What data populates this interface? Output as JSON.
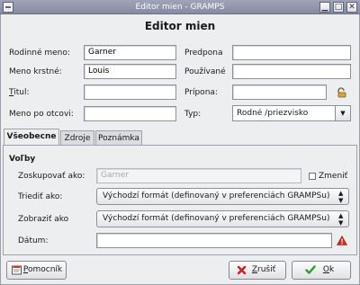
{
  "window": {
    "title": "Editor mien - GRAMPS",
    "menu_icon": "window-menu-icon",
    "controls": [
      "minimize-icon",
      "maximize-icon",
      "close-icon"
    ],
    "minimize_glyph": "▁",
    "maximize_glyph": "□",
    "close_glyph": "✕"
  },
  "heading": "Editor mien",
  "fields": {
    "rodinne_meno": {
      "label": "Rodinné meno:",
      "value": "Garner"
    },
    "predpona": {
      "label": "Predpona",
      "value": ""
    },
    "meno_krstne": {
      "label": "Meno krstné:",
      "value": "Louis"
    },
    "pouzivane": {
      "label": "Používané",
      "value": ""
    },
    "titul": {
      "label_mnemonic": "T",
      "label_rest": "itul:",
      "value": ""
    },
    "pripona": {
      "label": "Prípona:",
      "value": ""
    },
    "meno_po_otcovi": {
      "label": "Meno po otcovi:",
      "value": ""
    },
    "typ": {
      "label": "Typ:",
      "value": "Rodné /priezvisko",
      "arrow": "▼"
    }
  },
  "icons": {
    "lock": "lock-icon",
    "date_warning": "date-warning-icon"
  },
  "tabs": [
    {
      "label": "Všeobecne",
      "active": true
    },
    {
      "label": "Zdroje",
      "active": false
    },
    {
      "label": "Poznámka",
      "active": false
    }
  ],
  "general": {
    "section_title": "Voľby",
    "zoskupovat": {
      "label": "Zoskupovať ako:",
      "placeholder": "Garner",
      "checkbox_label": "Zmeniť",
      "checkbox_checked": false
    },
    "triedit": {
      "label": "Triediť ako:",
      "value": "Východzí formát (definovaný v preferenciách GRAMPSu)"
    },
    "zobrazit": {
      "label": "Zobraziť ako",
      "value": "Východzí formát (definovaný v preferenciách GRAMPSu)"
    },
    "datum": {
      "label": "Dátum:",
      "value": ""
    },
    "updown_arrows": "▲▼"
  },
  "buttons": {
    "help": {
      "mnemonic": "P",
      "rest": "omocník",
      "icon": "help-icon"
    },
    "cancel": {
      "mnemonic": "Z",
      "rest": "rušiť",
      "icon": "cancel-icon"
    },
    "ok": {
      "mnemonic": "O",
      "rest": "k",
      "icon": "ok-icon"
    }
  },
  "colors": {
    "title_bar": "#8f94aa",
    "window_bg": "#eceeef",
    "cancel_red": "#cc1f1f",
    "ok_green": "#2f9e2f",
    "warning_red": "#d22d1c",
    "lock_gold": "#c98a2a"
  }
}
